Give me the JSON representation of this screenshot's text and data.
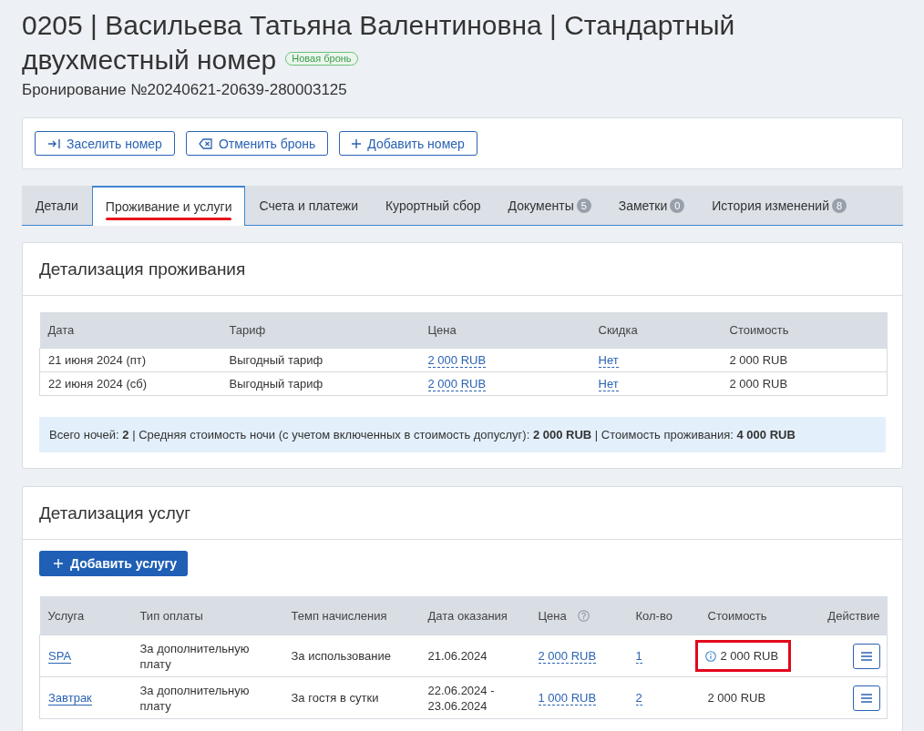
{
  "header": {
    "title_lines": [
      "0205 | Васильева Татьяна Валентиновна | Стандартный",
      "двухместный номер"
    ],
    "status_badge": "Новая бронь",
    "booking_number": "Бронирование №20240621-20639-280003125"
  },
  "actions": [
    {
      "label": "Заселить номер",
      "kind": "check_in"
    },
    {
      "label": "Отменить бронь",
      "kind": "cancel"
    },
    {
      "label": "Добавить номер",
      "kind": "add"
    }
  ],
  "tabs": [
    {
      "label": "Детали",
      "selected": false,
      "highlighted": false
    },
    {
      "label": "Проживание и услуги",
      "selected": true,
      "highlighted": true
    },
    {
      "label": "Счета и платежи",
      "selected": false,
      "highlighted": false
    },
    {
      "label": "Курортный сбор",
      "selected": false,
      "highlighted": false
    },
    {
      "label": "Документы",
      "count": "5",
      "selected": false,
      "highlighted": false
    },
    {
      "label": "Заметки",
      "count": "0",
      "selected": false,
      "highlighted": false
    },
    {
      "label": "История изменений",
      "count": "8",
      "selected": false,
      "highlighted": false
    }
  ],
  "stay": {
    "title": "Детализация проживания",
    "columns": [
      "Дата",
      "Тариф",
      "Цена",
      "Скидка",
      "Стоимость"
    ],
    "rows": [
      {
        "date": "21 июня 2024 (пт)",
        "tariff": "Выгодный тариф",
        "price": "2 000 RUB",
        "discount": "Нет",
        "cost": "2 000 RUB"
      },
      {
        "date": "22 июня 2024 (сб)",
        "tariff": "Выгодный тариф",
        "price": "2 000 RUB",
        "discount": "Нет",
        "cost": "2 000 RUB"
      }
    ],
    "summary": "Всего ночей: **2** | Средняя стоимость ночи (с учетом включенных в стоимость допуслуг): **2 000 RUB** | Стоимость проживания: **4 000 RUB**"
  },
  "services": {
    "title": "Детализация услуг",
    "add_button": "Добавить услугу",
    "columns": [
      {
        "label": "Услуга",
        "help": false
      },
      {
        "label": "Тип оплаты",
        "help": false
      },
      {
        "label": "Темп начисления",
        "help": false
      },
      {
        "label": "Дата оказания",
        "help": false
      },
      {
        "label": "Цена",
        "help": true
      },
      {
        "label": "Кол-во",
        "help": false
      },
      {
        "label": "Стоимость",
        "help": false
      },
      {
        "label": "Действие",
        "help": false
      }
    ],
    "rows": [
      {
        "service": "SPA",
        "payment_type": "За дополнительную плату",
        "accrual": "За использование",
        "date": "21.06.2024",
        "price": "2 000 RUB",
        "quantity": "1",
        "cost": "2 000 RUB",
        "cost_info": true,
        "highlighted": true
      },
      {
        "service": "Завтрак",
        "payment_type": "За дополнительную плату",
        "accrual": "За гостя в сутки",
        "date": "22.06.2024 - 23.06.2024",
        "price": "1 000 RUB",
        "quantity": "2",
        "cost": "2 000 RUB",
        "cost_info": false,
        "highlighted": false
      }
    ]
  }
}
